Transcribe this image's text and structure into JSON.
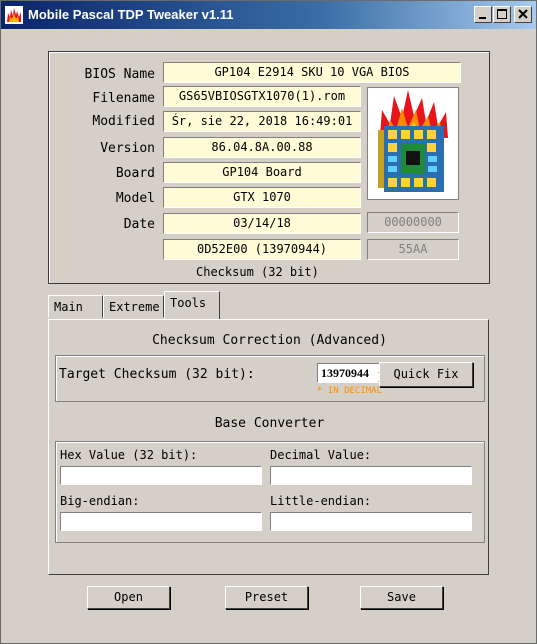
{
  "window": {
    "title": "Mobile Pascal TDP Tweaker v1.11"
  },
  "bios": {
    "labels": {
      "bios_name": "BIOS Name",
      "filename": "Filename",
      "modified": "Modified",
      "version": "Version",
      "board": "Board",
      "model": "Model",
      "date": "Date"
    },
    "bios_name": "GP104 E2914 SKU 10 VGA BIOS",
    "filename": "GS65VBIOSGTX1070(1).rom",
    "modified": "Śr, sie 22, 2018 16:49:01",
    "version": "86.04.8A.00.88",
    "board": "GP104 Board",
    "model": "GTX 1070",
    "date": "03/14/18",
    "date_extra": "00000000",
    "checksum": "0D52E00 (13970944)",
    "checksum_extra": "55AA",
    "checksum_caption": "Checksum (32 bit)"
  },
  "tabs": [
    {
      "label": "Main"
    },
    {
      "label": "Extreme"
    },
    {
      "label": "Tools"
    }
  ],
  "tools": {
    "checksum_title": "Checksum Correction (Advanced)",
    "target_label": "Target Checksum (32 bit):",
    "target_value": "13970944",
    "hint": "* IN DECIMAL",
    "quick_fix_label": "Quick Fix",
    "converter_title": "Base Converter",
    "hex_label": "Hex Value (32 bit):",
    "decimal_label": "Decimal Value:",
    "big_endian_label": "Big-endian:",
    "little_endian_label": "Little-endian:",
    "hex_value": "",
    "decimal_value": "",
    "big_endian_value": "",
    "little_endian_value": ""
  },
  "buttons": {
    "open": "Open",
    "preset": "Preset",
    "save": "Save"
  }
}
